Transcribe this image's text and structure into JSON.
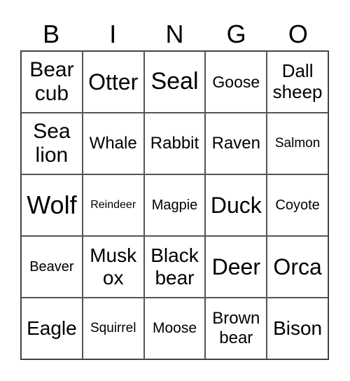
{
  "header": [
    "B",
    "I",
    "N",
    "G",
    "O"
  ],
  "cells": [
    "Bear cub",
    "Otter",
    "Seal",
    "Goose",
    "Dall sheep",
    "Sea lion",
    "Whale",
    "Rabbit",
    "Raven",
    "Salmon",
    "Wolf",
    "Reindeer",
    "Magpie",
    "Duck",
    "Coyote",
    "Beaver",
    "Musk ox",
    "Black bear",
    "Deer",
    "Orca",
    "Eagle",
    "Squirrel",
    "Moose",
    "Brown bear",
    "Bison"
  ]
}
